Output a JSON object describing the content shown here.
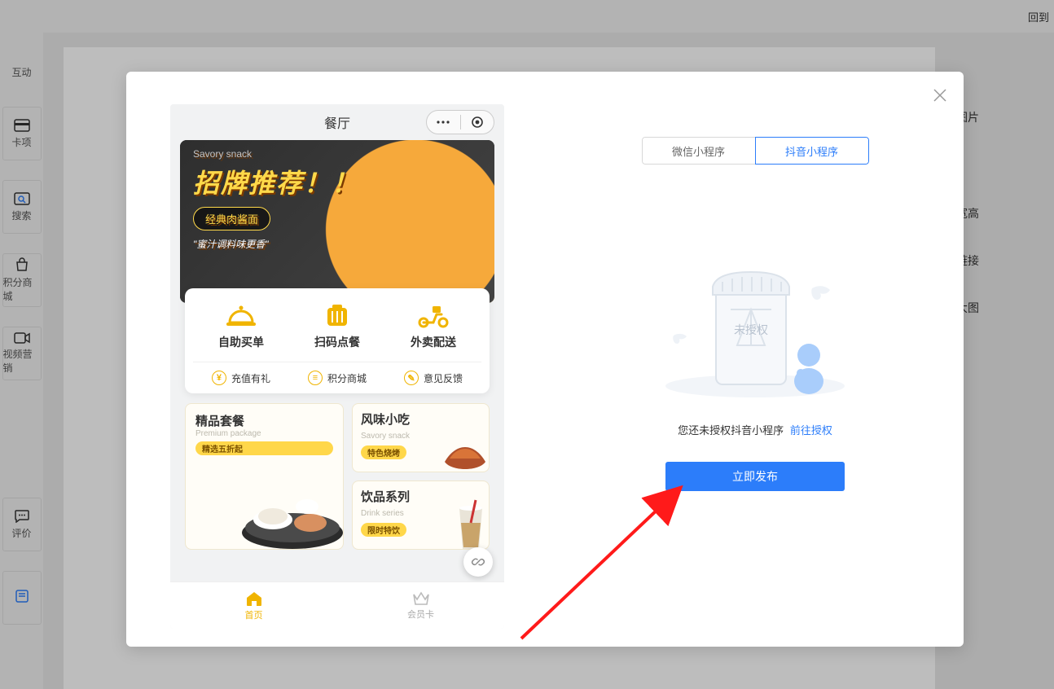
{
  "top": {
    "back": "回到"
  },
  "sidebar": {
    "items": [
      {
        "label": "互动"
      },
      {
        "label": "卡项"
      },
      {
        "label": "搜索"
      },
      {
        "label": "积分商城"
      },
      {
        "label": "视频营销"
      },
      {
        "label": "评价"
      }
    ]
  },
  "right_panel": {
    "labels": [
      "图片",
      "宽高",
      "链接",
      "大图"
    ]
  },
  "modal": {
    "phone": {
      "title": "餐厅",
      "banner": {
        "brand": "Savory snack",
        "headline": "招牌推荐！！",
        "badge": "经典肉酱面",
        "subline": "\"蜜汁调料味更香\""
      },
      "services": [
        {
          "label": "自助买单"
        },
        {
          "label": "扫码点餐"
        },
        {
          "label": "外卖配送"
        }
      ],
      "subservices": [
        {
          "label": "充值有礼"
        },
        {
          "label": "积分商城"
        },
        {
          "label": "意见反馈"
        }
      ],
      "categories": {
        "big": {
          "title": "精品套餐",
          "sub": "Premium package",
          "tag": "精选五折起"
        },
        "small": [
          {
            "title": "风味小吃",
            "sub": "Savory snack",
            "tag": "特色烧烤"
          },
          {
            "title": "饮品系列",
            "sub": "Drink series",
            "tag": "限时特饮"
          }
        ]
      },
      "tabs": [
        {
          "label": "首页"
        },
        {
          "label": "会员卡"
        }
      ]
    },
    "platform_tabs": [
      {
        "label": "微信小程序"
      },
      {
        "label": "抖音小程序"
      }
    ],
    "empty_badge": "未授权",
    "auth_message": "您还未授权抖音小程序",
    "auth_link": "前往授权",
    "publish": "立即发布"
  }
}
